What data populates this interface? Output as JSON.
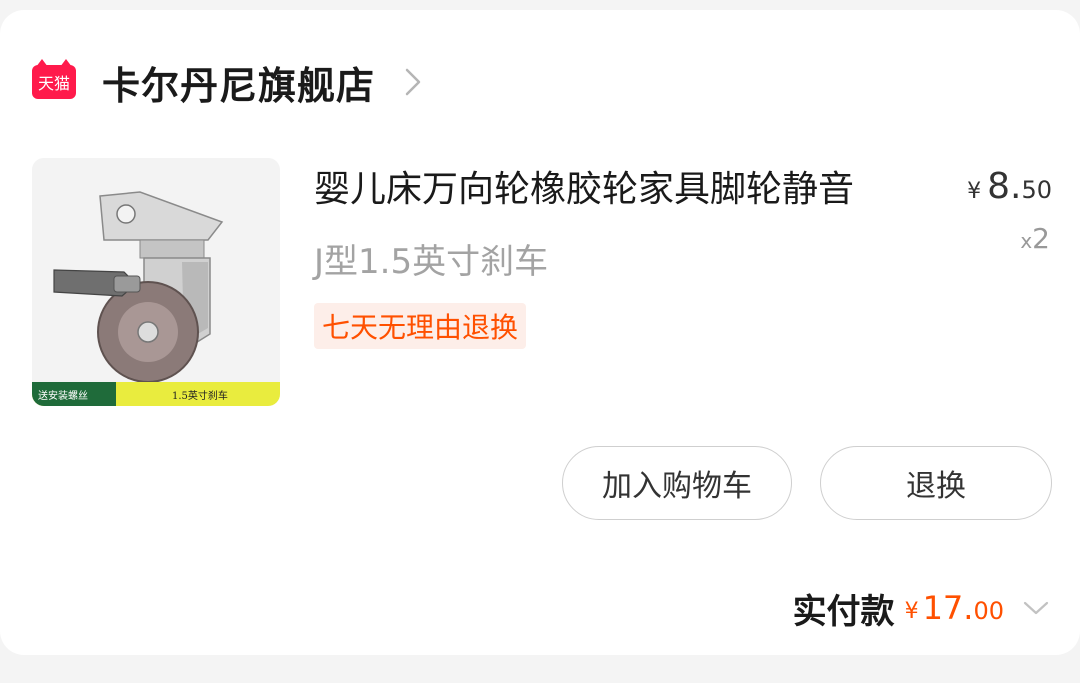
{
  "store": {
    "logo_text": "天猫",
    "name": "卡尔丹尼旗舰店"
  },
  "product": {
    "image_caption_left": "送安装螺丝",
    "image_caption_right": "1.5英寸刹车",
    "title": "婴儿床万向轮橡胶轮家具脚轮静音",
    "variant": "J型1.5英寸刹车",
    "tag": "七天无理由退换",
    "price_symbol": "¥",
    "price_int": "8.",
    "price_dec": "50",
    "qty_prefix": "x",
    "qty": "2"
  },
  "actions": {
    "add_to_cart": "加入购物车",
    "return_exchange": "退换"
  },
  "total": {
    "label": "实付款",
    "symbol": "¥",
    "int": "17.",
    "dec": "00"
  },
  "colors": {
    "accent": "#ff5000",
    "tmall_red": "#ff1a4b"
  },
  "icons": {
    "store_chevron": "chevron-right-icon",
    "total_chevron": "chevron-down-icon"
  }
}
